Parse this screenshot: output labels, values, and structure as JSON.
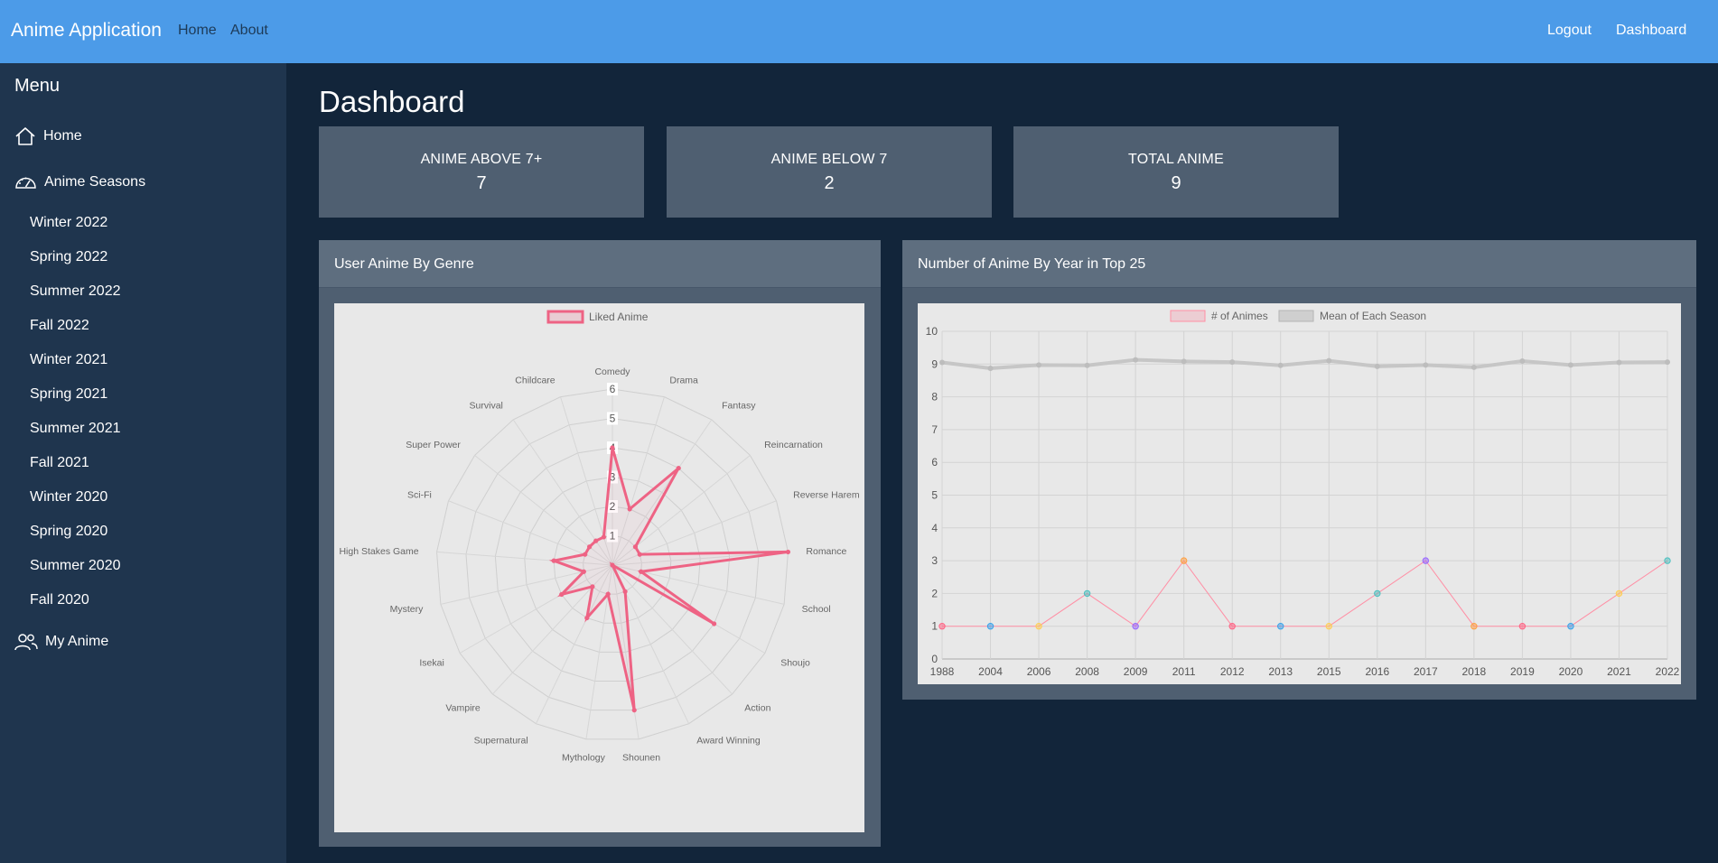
{
  "navbar": {
    "brand": "Anime Application",
    "links": [
      "Home",
      "About"
    ],
    "right_links": [
      "Logout",
      "Dashboard"
    ]
  },
  "sidebar": {
    "title": "Menu",
    "home": "Home",
    "seasons_label": "Anime Seasons",
    "seasons": [
      "Winter 2022",
      "Spring 2022",
      "Summer 2022",
      "Fall 2022",
      "Winter 2021",
      "Spring 2021",
      "Summer 2021",
      "Fall 2021",
      "Winter 2020",
      "Spring 2020",
      "Summer 2020",
      "Fall 2020"
    ],
    "my_anime": "My Anime"
  },
  "page_title": "Dashboard",
  "stats": [
    {
      "label": "ANIME ABOVE 7+",
      "value": "7"
    },
    {
      "label": "ANIME BELOW 7",
      "value": "2"
    },
    {
      "label": "TOTAL ANIME",
      "value": "9"
    }
  ],
  "cards": {
    "genre_title": "User Anime By Genre",
    "year_title": "Number of Anime By Year in Top 25"
  },
  "colors": {
    "navbar": "#4c9be8",
    "background": "#12253a",
    "sidebar": "#1f354e",
    "card": "#4f5f71",
    "accent_pink": "#ee6384",
    "mean_gray": "#c4c4c4"
  },
  "chart_data": [
    {
      "type": "radar",
      "legend": [
        "Liked Anime"
      ],
      "rlim": [
        0,
        6
      ],
      "ticks": [
        1,
        2,
        3,
        4,
        5,
        6
      ],
      "categories": [
        "Comedy",
        "Drama",
        "Fantasy",
        "Reincarnation",
        "Reverse Harem",
        "Romance",
        "School",
        "Shoujo",
        "Action",
        "Award Winning",
        "Shounen",
        "Mythology",
        "Supernatural",
        "Vampire",
        "Isekai",
        "Mystery",
        "High Stakes Game",
        "Sci-Fi",
        "Super Power",
        "Survival",
        "Childcare"
      ],
      "series": [
        {
          "name": "Liked Anime",
          "values": [
            4,
            2,
            4,
            1,
            1,
            6,
            1,
            4,
            0,
            1,
            5,
            1,
            2,
            1,
            2,
            1,
            2,
            1,
            1,
            1,
            1
          ]
        }
      ]
    },
    {
      "type": "line",
      "legend": [
        "# of Animes",
        "Mean of Each Season"
      ],
      "x": [
        "1988",
        "2004",
        "2006",
        "2008",
        "2009",
        "2011",
        "2012",
        "2013",
        "2015",
        "2016",
        "2017",
        "2018",
        "2019",
        "2020",
        "2021",
        "2022"
      ],
      "ylim": [
        0,
        10
      ],
      "series": [
        {
          "name": "# of Animes",
          "values": [
            1,
            1,
            1,
            2,
            1,
            3,
            1,
            1,
            1,
            2,
            3,
            1,
            1,
            1,
            2,
            3
          ]
        },
        {
          "name": "Mean of Each Season",
          "values": [
            9.05,
            8.87,
            8.97,
            8.96,
            9.13,
            9.08,
            9.06,
            8.96,
            9.1,
            8.93,
            8.97,
            8.9,
            9.09,
            8.97,
            9.05,
            9.06
          ]
        }
      ],
      "point_colors": [
        "#ff6384",
        "#36a2eb",
        "#ffce56",
        "#4bc0c0",
        "#9966ff",
        "#ff9f40",
        "#ff6384",
        "#36a2eb",
        "#ffce56",
        "#4bc0c0",
        "#9966ff",
        "#ff9f40",
        "#ff6384",
        "#36a2eb",
        "#ffce56",
        "#4bc0c0"
      ]
    }
  ]
}
